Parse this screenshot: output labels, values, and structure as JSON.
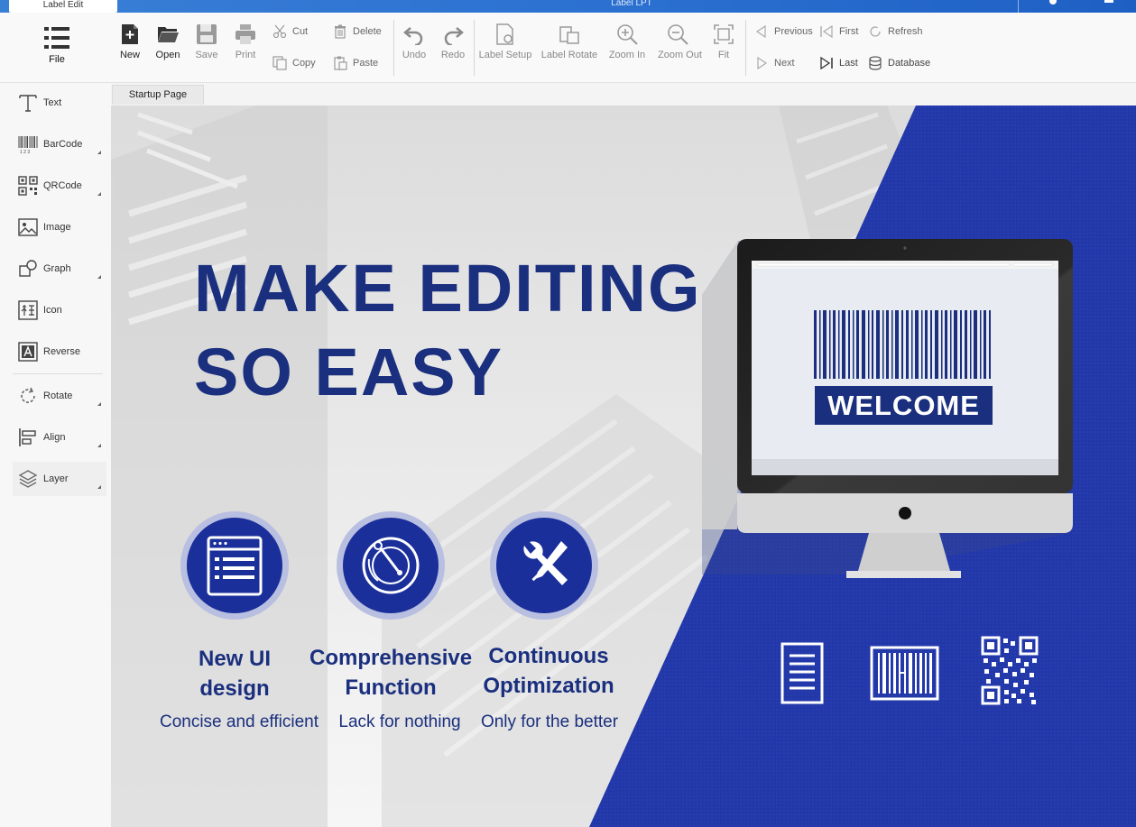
{
  "titlebar": {
    "app_tab": "Label Edit",
    "window_title": "Label LPT"
  },
  "ribbon": {
    "file": "File",
    "new": "New",
    "open": "Open",
    "save": "Save",
    "print": "Print",
    "cut": "Cut",
    "copy": "Copy",
    "delete": "Delete",
    "paste": "Paste",
    "undo": "Undo",
    "redo": "Redo",
    "label_setup": "Label Setup",
    "label_rotate": "Label Rotate",
    "zoom_in": "Zoom In",
    "zoom_out": "Zoom Out",
    "fit": "Fit",
    "previous": "Previous",
    "first": "First",
    "refresh": "Refresh",
    "next": "Next",
    "last": "Last",
    "database": "Database"
  },
  "sidebar": {
    "items": [
      {
        "label": "Text"
      },
      {
        "label": "BarCode"
      },
      {
        "label": "QRCode"
      },
      {
        "label": "Image"
      },
      {
        "label": "Graph"
      },
      {
        "label": "Icon"
      },
      {
        "label": "Reverse"
      },
      {
        "label": "Rotate"
      },
      {
        "label": "Align"
      },
      {
        "label": "Layer"
      }
    ]
  },
  "tab": {
    "label": "Startup Page"
  },
  "banner": {
    "headline_line1": "MAKE EDITING",
    "headline_line2": "SO EASY",
    "screen_label": "WELCOME",
    "features": [
      {
        "title_line1": "New UI",
        "title_line2": "design",
        "subtitle": "Concise and efficient"
      },
      {
        "title_line1": "Comprehensive",
        "title_line2": "Function",
        "subtitle": "Lack for nothing"
      },
      {
        "title_line1": "Continuous",
        "title_line2": "Optimization",
        "subtitle": "Only for the better"
      }
    ]
  },
  "colors": {
    "brand_navy": "#1a2f7e",
    "brand_blue": "#2237a8",
    "titlebar_blue": "#2a6fd0"
  }
}
